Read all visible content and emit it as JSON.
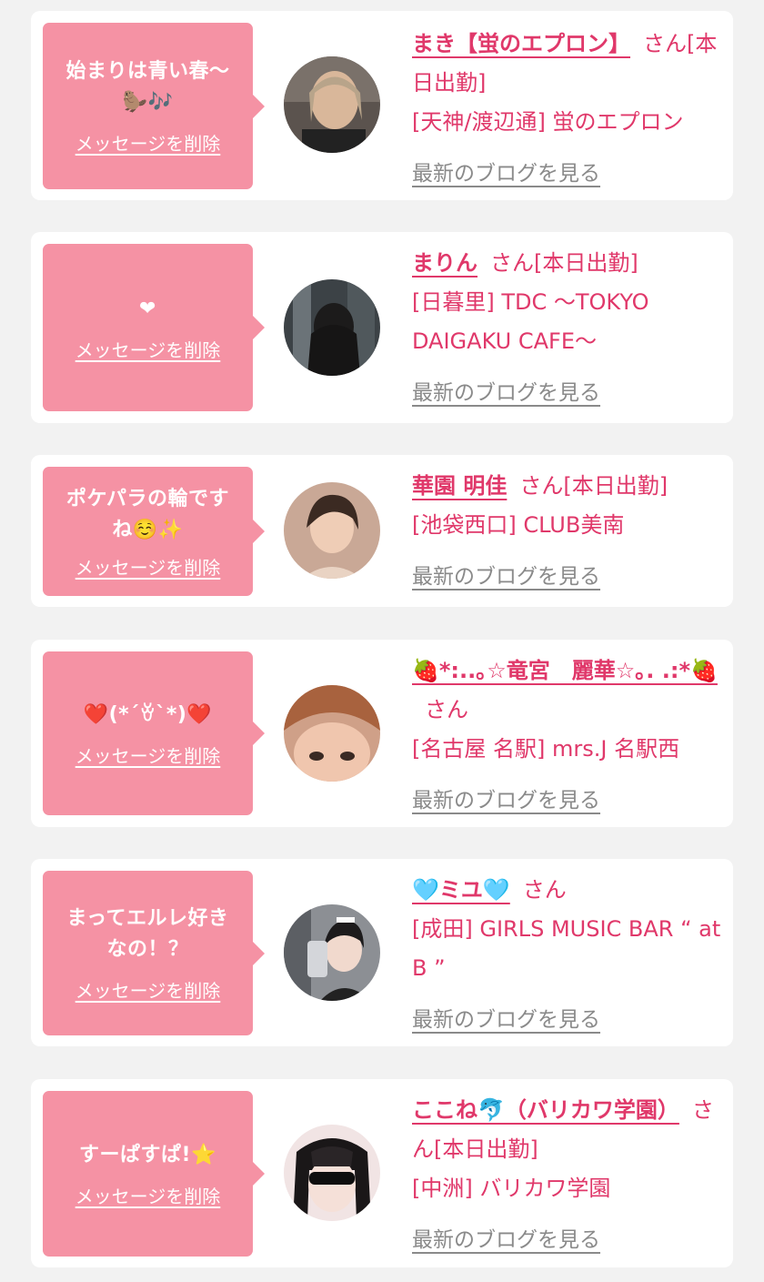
{
  "colors": {
    "page_bg": "#f2f2f2",
    "card_bg": "#ffffff",
    "bubble_bg": "#f592a4",
    "accent": "#e0386a",
    "muted_link": "#8a8a8a"
  },
  "labels": {
    "delete_message": "メッセージを削除",
    "san": "さん",
    "blog_link": "最新のブログを見る"
  },
  "cards": [
    {
      "message_line1": "始まりは青い春〜",
      "message_line2": "🦫🎶",
      "name": "まき【蛍のエプロン】",
      "status": "[本日出勤]",
      "shop": "[天神/渡辺通] 蛍のエプロン",
      "avatar_icon": "person-photo"
    },
    {
      "message_line1": "❤",
      "message_line2": "",
      "name": "まりん",
      "status": "[本日出勤]",
      "shop": "[日暮里] TDC 〜TOKYO DAIGAKU CAFE〜",
      "avatar_icon": "person-photo"
    },
    {
      "message_line1": "ポケパラの輪です",
      "message_line2": "ね☺️✨",
      "name": "華園 明佳",
      "status": "[本日出勤]",
      "shop": "[池袋西口] CLUB美南",
      "avatar_icon": "person-photo"
    },
    {
      "message_line1": "❤️(*´ꈊ`*)❤️",
      "message_line2": "",
      "name": "🍓*:..｡☆竜宮　麗華☆｡. .:*🍓",
      "status": "",
      "shop": "[名古屋 名駅] mrs.J 名駅西",
      "avatar_icon": "person-photo"
    },
    {
      "message_line1": "まってエルレ好き",
      "message_line2": "なの！？",
      "name": "🩵ミユ🩵",
      "status": "",
      "shop": "[成田] GIRLS MUSIC BAR “ at B ”",
      "avatar_icon": "person-photo"
    },
    {
      "message_line1": "すーぱすぱ!⭐",
      "message_line2": "",
      "name": "ここね🐬（バリカワ学園）",
      "status": "[本日出勤]",
      "shop": "[中洲] バリカワ学園",
      "avatar_icon": "person-photo"
    }
  ]
}
